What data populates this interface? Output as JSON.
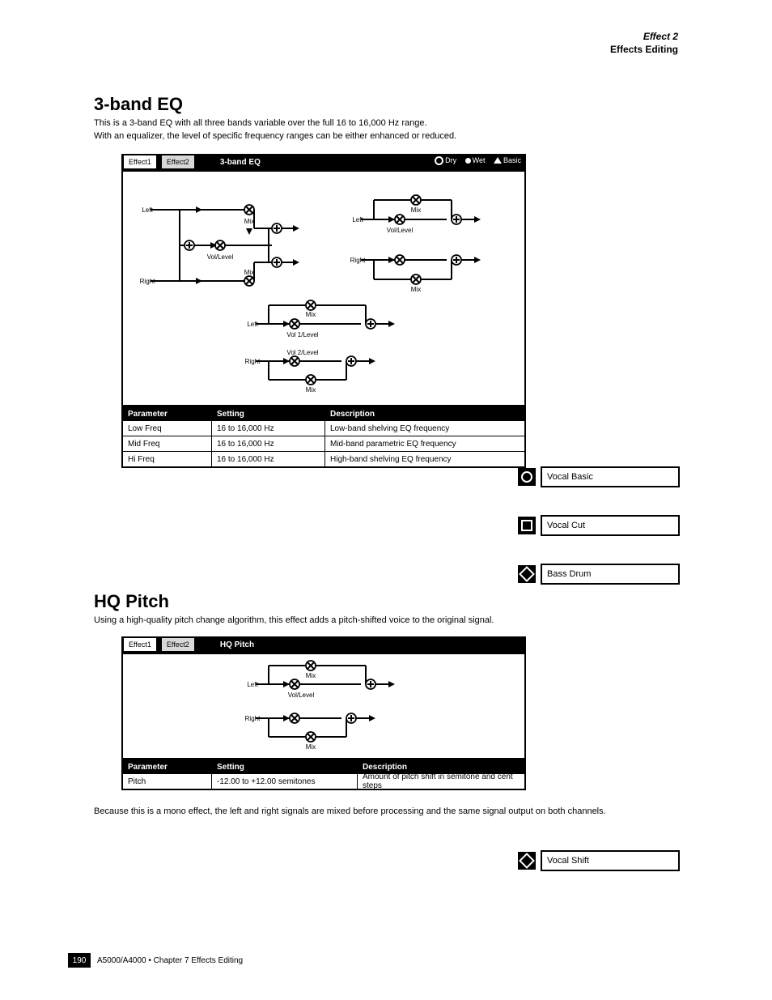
{
  "header": {
    "right1": "Effect 2",
    "right2": "Effects Editing"
  },
  "section1": {
    "title": "3-band EQ",
    "desc_a": "This is a 3-band EQ with all three bands variable over the full 16 to 16,000 Hz range.",
    "desc_b": "With an equalizer, the level of specific frequency ranges can be either enhanced or reduced.",
    "tabs": {
      "t1": "Effect1",
      "t2": "Effect2"
    },
    "tab_title": "3-band EQ",
    "marker": {
      "dry": "Dry",
      "wet": "Wet",
      "base": "Basic"
    },
    "diag_labels": {
      "left": "Left",
      "right": "Right",
      "mix": "Mix",
      "vol": "Vol/Level",
      "vol1": "Vol 1/Level",
      "vol2": "Vol 2/Level"
    },
    "params": {
      "h": [
        "Parameter",
        "Setting",
        "Description"
      ],
      "r1": [
        "Low Freq",
        "16 to 16,000 Hz",
        "Low-band shelving EQ frequency"
      ],
      "r2": [
        "Mid Freq",
        "16 to 16,000 Hz",
        "Mid-band parametric EQ frequency"
      ],
      "r3": [
        "Hi Freq",
        "16 to 16,000 Hz",
        "High-band shelving EQ frequency"
      ]
    },
    "badges": [
      {
        "shape": "circle",
        "label": "Vocal Basic"
      },
      {
        "shape": "square",
        "label": "Vocal Cut"
      },
      {
        "shape": "diamond",
        "label": "Bass Drum"
      }
    ]
  },
  "section2": {
    "title": "HQ Pitch",
    "desc_a": "Using a high-quality pitch change algorithm, this effect adds a pitch-shifted voice to the original signal.",
    "desc_b": "Because this is a mono effect, the left and right signals are mixed before processing and the same signal output on both channels.",
    "tabs": {
      "t1": "Effect1",
      "t2": "Effect2"
    },
    "tab_title": "HQ Pitch",
    "diag_labels": {
      "left": "Left",
      "right": "Right",
      "mix": "Mix",
      "vol": "Vol/Level"
    },
    "params": {
      "h": [
        "Parameter",
        "Setting",
        "Description"
      ],
      "r1": [
        "Pitch",
        "-12.00 to +12.00 semitones",
        "Amount of pitch shift in semitone and cent steps"
      ]
    },
    "badge": {
      "shape": "diamond",
      "label": "Vocal Shift"
    }
  },
  "footer": {
    "manual": "A5000/A4000  •  Chapter 7  Effects Editing",
    "page": "190"
  }
}
